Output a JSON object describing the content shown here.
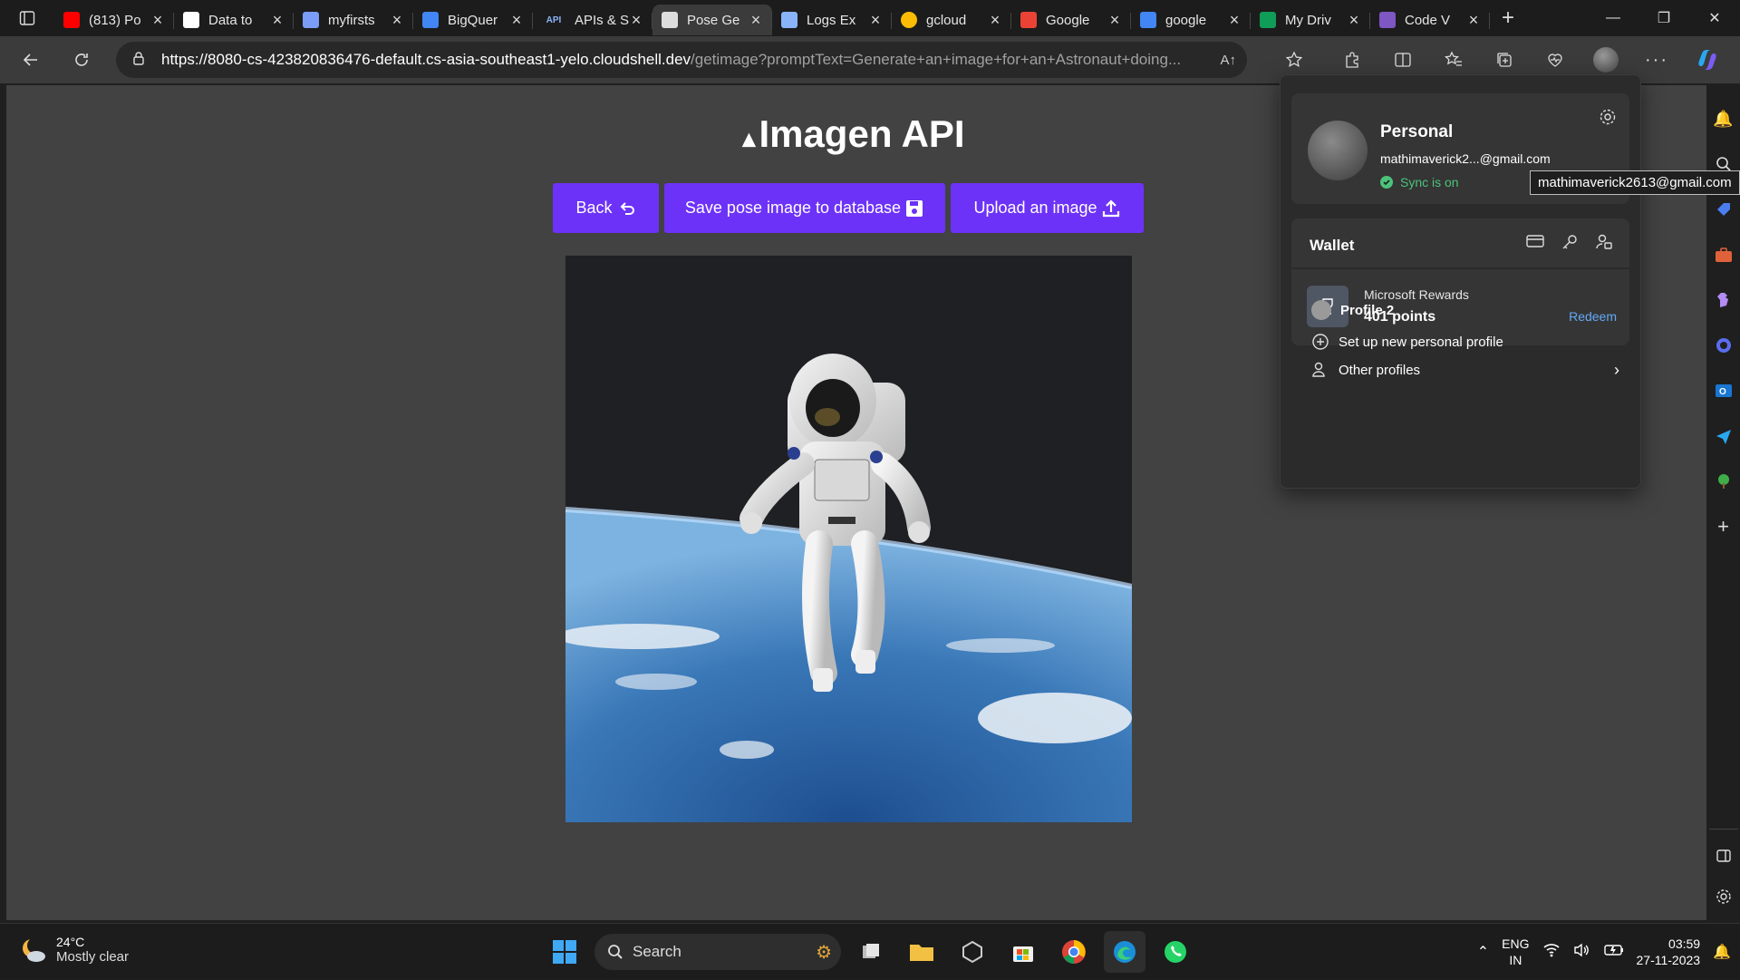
{
  "browser": {
    "tabs": [
      {
        "title": "(813) Po",
        "icon": "youtube-icon",
        "color": "#ff0000"
      },
      {
        "title": "Data to",
        "icon": "looker-studio-icon",
        "color": "#ffffff"
      },
      {
        "title": "myfirsts",
        "icon": "vertex-ai-icon",
        "color": "#7a9df7"
      },
      {
        "title": "BigQuer",
        "icon": "bigquery-icon",
        "color": "#4285f4"
      },
      {
        "title": "APIs & S",
        "icon": "api-icon",
        "color": "#8ab4f8",
        "badge": "API"
      },
      {
        "title": "Pose Ge",
        "icon": "document-icon",
        "color": "#dddddd",
        "active": true
      },
      {
        "title": "Logs Ex",
        "icon": "logs-icon",
        "color": "#8ab4f8"
      },
      {
        "title": "gcloud",
        "icon": "chrome-icon",
        "color": "#fbbc04"
      },
      {
        "title": "Google",
        "icon": "google-cloud-icon",
        "color": "#ea4335"
      },
      {
        "title": "google",
        "icon": "search-icon",
        "color": "#4285f4"
      },
      {
        "title": "My Driv",
        "icon": "drive-icon",
        "color": "#0f9d58"
      },
      {
        "title": "Code V",
        "icon": "code-icon",
        "color": "#7e57c2"
      }
    ],
    "url_host": "https://8080-cs-423820836476-default.cs-asia-southeast1-yelo.cloudshell.dev",
    "url_path": "/getimage?promptText=Generate+an+image+for+an+Astronaut+doing..."
  },
  "page": {
    "title": "Imagen API",
    "buttons": {
      "back": "Back",
      "save": "Save pose image to database",
      "upload": "Upload an image"
    }
  },
  "profile_flyout": {
    "name": "Personal",
    "email": "mathimaverick2...@gmail.com",
    "sync": "Sync is on",
    "tooltip": "mathimaverick2613@gmail.com",
    "wallet_title": "Wallet",
    "rewards_label": "Microsoft Rewards",
    "rewards_points": "401 points",
    "redeem": "Redeem",
    "profile2": "Profile 2",
    "setup": "Set up new personal profile",
    "other": "Other profiles"
  },
  "taskbar": {
    "temp": "24°C",
    "weather": "Mostly clear",
    "search": "Search",
    "lang1": "ENG",
    "lang2": "IN",
    "time": "03:59",
    "date": "27-11-2023"
  }
}
